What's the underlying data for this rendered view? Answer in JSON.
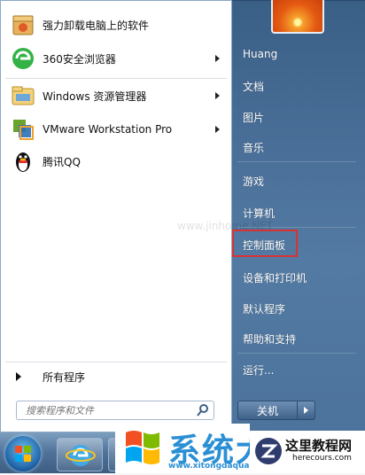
{
  "start_menu": {
    "programs": [
      {
        "label": "强力卸载电脑上的软件",
        "icon": "uninstall-box-icon",
        "submenu": false
      },
      {
        "label": "360安全浏览器",
        "icon": "360-browser-icon",
        "submenu": true
      },
      {
        "label": "Windows 资源管理器",
        "icon": "folder-explorer-icon",
        "submenu": true
      },
      {
        "label": "VMware Workstation Pro",
        "icon": "vmware-icon",
        "submenu": true
      },
      {
        "label": "腾讯QQ",
        "icon": "qq-penguin-icon",
        "submenu": false
      }
    ],
    "all_programs_label": "所有程序",
    "search_placeholder": "搜索程序和文件",
    "right_items": [
      "Huang",
      "文档",
      "图片",
      "音乐",
      "游戏",
      "计算机",
      "控制面板",
      "设备和打印机",
      "默认程序",
      "帮助和支持",
      "运行..."
    ],
    "shutdown_label": "关机",
    "highlighted_item": "控制面板"
  },
  "watermarks": {
    "cn_title": "系统大全",
    "cn_sub": "www.xitongdaquan.com",
    "en_title": "这里教程网",
    "en_url": "herecours.com",
    "center_faint": "www.jinhome.NET"
  },
  "colors": {
    "right_pane": "#4a7099",
    "highlight_border": "#d93232",
    "watermark_blue": "#2a8fd4"
  }
}
